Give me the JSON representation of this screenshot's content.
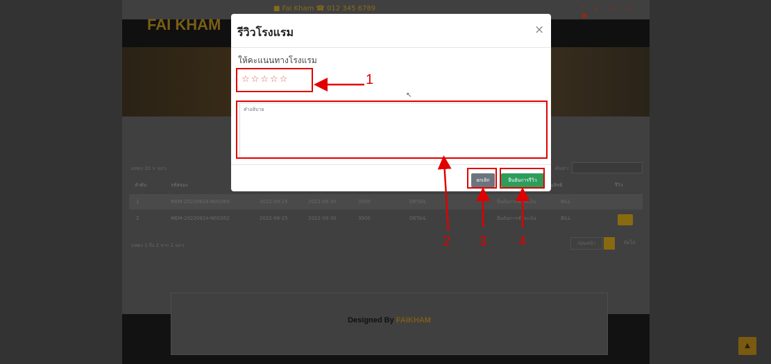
{
  "site": {
    "logo": "FAI KHAM",
    "contact": "■ Fai Kham   ☎ 012 345 6789",
    "social": "f y in o ■",
    "footer_designed": "Designed By",
    "footer_brand": "FAIKHAM"
  },
  "table": {
    "length_label": "แสดง  10  ∨  แถว",
    "search_label": "ค้นหา:",
    "headers": [
      "ลำดับ",
      "รหัสจอง",
      "",
      "",
      "",
      "",
      "",
      "ผู้ถอนสิทธิ",
      "รีวิว"
    ],
    "rows": [
      [
        "1",
        "MEM-20220924-N00264",
        "2022-09-25",
        "2022-09-30",
        "3500",
        "DETAIL",
        "ยืนยันการชำระเงิน",
        "BILL"
      ],
      [
        "2",
        "MEM-20220924-N00262",
        "2022-09-25",
        "2022-09-30",
        "3500",
        "DETAIL",
        "ยืนยันการชำระเงิน",
        "BILL"
      ]
    ],
    "info": "แสดง 1 ถึง 2 จาก 2 แถว",
    "pager_prev": "ก่อนหน้า",
    "pager_next": "ถัดไป"
  },
  "modal": {
    "title": "รีวิวโรงแรม",
    "close": "×",
    "rate_label": "ให้คะแนนทางโรงแรม",
    "stars": "☆☆☆☆☆",
    "rating": 0,
    "description_placeholder": "คำอธิบาย",
    "cancel_label": "ยกเลิก",
    "submit_label": "ยืนยันการรีวิว"
  },
  "annotations": {
    "n1": "1",
    "n2": "2",
    "n3": "3",
    "n4": "4"
  },
  "colors": {
    "annotation": "#e00000",
    "submit": "#2e9d5c",
    "cancel": "#6c757d",
    "accent": "#8a6a10"
  }
}
